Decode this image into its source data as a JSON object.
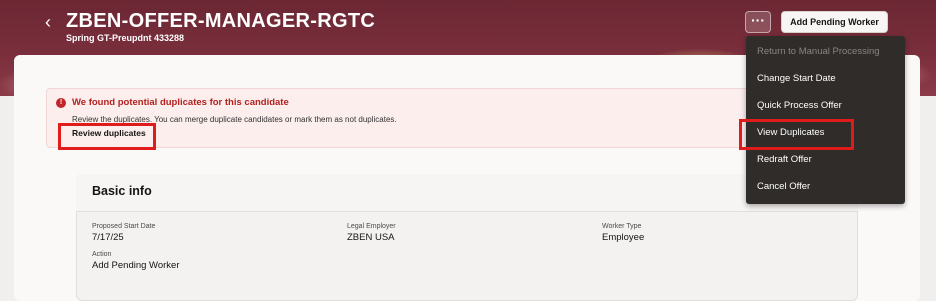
{
  "header": {
    "title": "ZBEN-OFFER-MANAGER-RGTC",
    "subtitle": "Spring GT-Preupdnt 433288",
    "back_icon": "chevron-left-icon",
    "more_label": "···",
    "primary_action": "Add Pending Worker"
  },
  "alert": {
    "icon": "error-icon",
    "title": "We found potential duplicates for this candidate",
    "message": "Review the duplicates. You can merge duplicate candidates or mark them as not duplicates.",
    "link": "Review duplicates"
  },
  "basic_info": {
    "title": "Basic info",
    "fields": [
      {
        "label": "Proposed Start Date",
        "value": "7/17/25"
      },
      {
        "label": "Legal Employer",
        "value": "ZBEN USA"
      },
      {
        "label": "Worker Type",
        "value": "Employee"
      },
      {
        "label": "Action",
        "value": "Add Pending Worker"
      }
    ]
  },
  "menu": {
    "items": [
      {
        "label": "Return to Manual Processing",
        "enabled": false
      },
      {
        "label": "Change Start Date",
        "enabled": true
      },
      {
        "label": "Quick Process Offer",
        "enabled": true
      },
      {
        "label": "View Duplicates",
        "enabled": true
      },
      {
        "label": "Redraft Offer",
        "enabled": true
      },
      {
        "label": "Cancel Offer",
        "enabled": true
      }
    ]
  },
  "colors": {
    "banner": "#7a2e3c",
    "alert_red": "#b3211f",
    "highlight": "#e01b1b",
    "menu_bg": "#2f2c29"
  }
}
